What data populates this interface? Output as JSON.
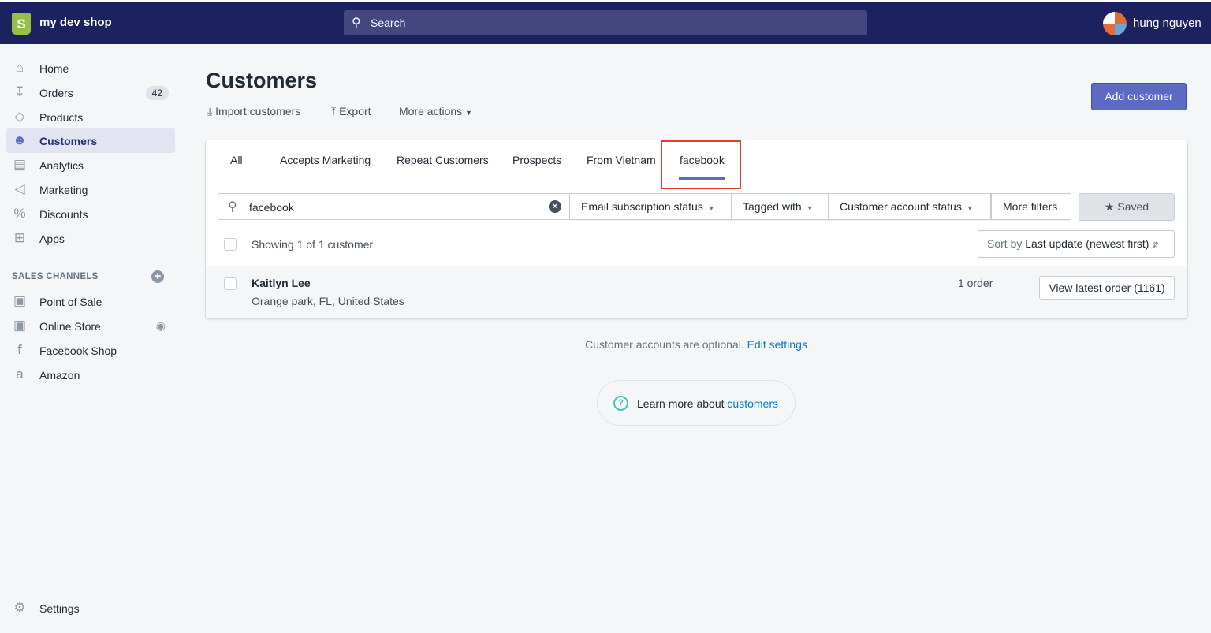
{
  "topbar": {
    "shop_name": "my dev shop",
    "search_placeholder": "Search",
    "user_name": "hung nguyen"
  },
  "sidebar": {
    "items": [
      {
        "label": "Home",
        "icon": "home-icon"
      },
      {
        "label": "Orders",
        "icon": "orders-icon",
        "badge": "42"
      },
      {
        "label": "Products",
        "icon": "tag-icon"
      },
      {
        "label": "Customers",
        "icon": "person-icon",
        "active": true
      },
      {
        "label": "Analytics",
        "icon": "bar-chart-icon"
      },
      {
        "label": "Marketing",
        "icon": "megaphone-icon"
      },
      {
        "label": "Discounts",
        "icon": "discount-icon"
      },
      {
        "label": "Apps",
        "icon": "apps-icon"
      }
    ],
    "sales_channels_heading": "SALES CHANNELS",
    "channels": [
      {
        "label": "Point of Sale"
      },
      {
        "label": "Online Store"
      },
      {
        "label": "Facebook Shop"
      },
      {
        "label": "Amazon"
      }
    ],
    "settings": "Settings"
  },
  "page": {
    "title": "Customers",
    "import": "Import customers",
    "export": "Export",
    "more_actions": "More actions",
    "add_customer": "Add customer"
  },
  "tabs": [
    "All",
    "Accepts Marketing",
    "Repeat Customers",
    "Prospects",
    "From Vietnam",
    "facebook"
  ],
  "filters": {
    "search_value": "facebook",
    "email_status": "Email subscription status",
    "tagged_with": "Tagged with",
    "account_status": "Customer account status",
    "more_filters": "More filters",
    "saved": "Saved"
  },
  "list": {
    "showing": "Showing 1 of 1 customer",
    "sort_prefix": "Sort by",
    "sort_value": "Last update (newest first)",
    "customers": [
      {
        "name": "Kaitlyn Lee",
        "location": "Orange park, FL, United States",
        "orders": "1 order",
        "action": "View latest order (1161)"
      }
    ]
  },
  "footer": {
    "note": "Customer accounts are optional.",
    "edit_settings": "Edit settings",
    "learn_prefix": "Learn more about",
    "learn_link": "customers"
  },
  "colors": {
    "topbar": "#1c2260",
    "accent": "#5c6ac4",
    "highlight": "#e53b2c"
  }
}
